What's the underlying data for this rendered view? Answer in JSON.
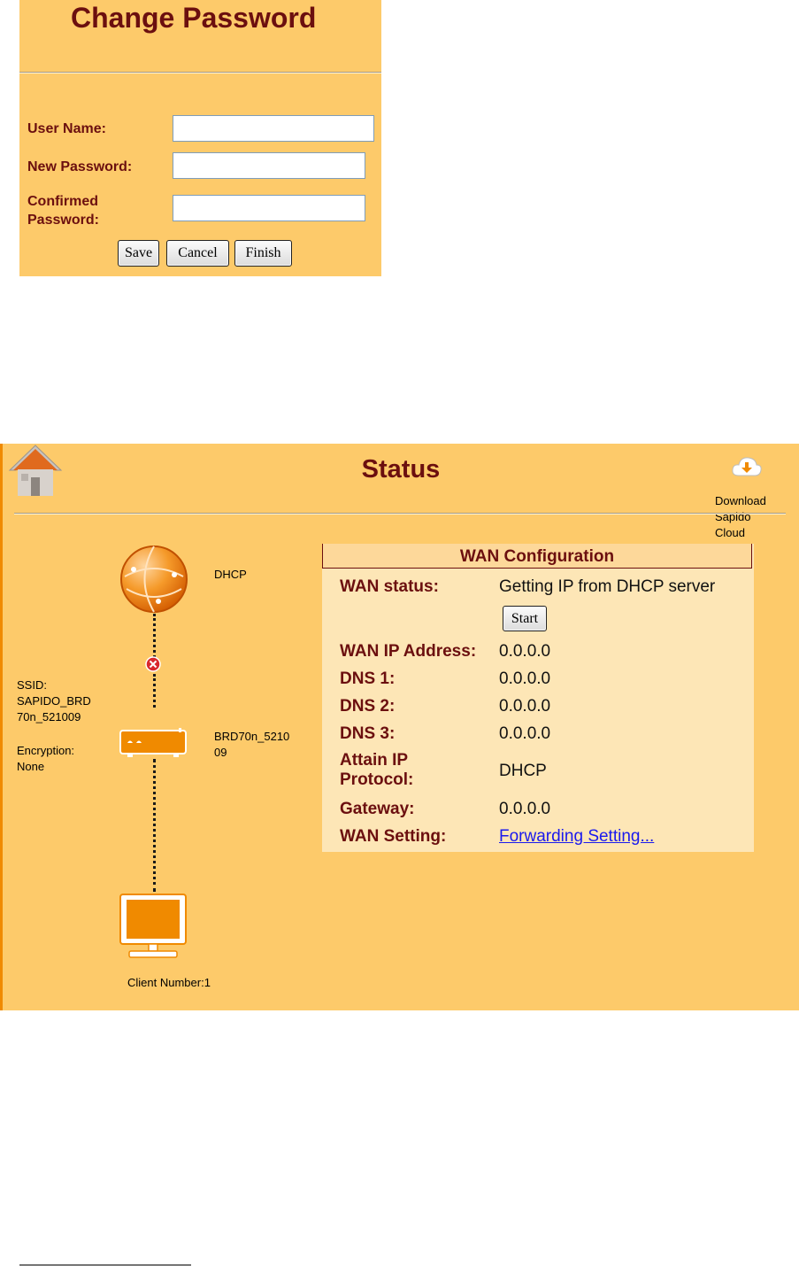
{
  "change_password": {
    "title": "Change Password",
    "user_name_label": "User Name:",
    "user_name_value": "",
    "new_password_label": "New Password:",
    "new_password_value": "",
    "confirmed_password_label_line1": "Confirmed",
    "confirmed_password_label_line2": "Password:",
    "confirmed_password_value": "",
    "buttons": {
      "save": "Save",
      "cancel": "Cancel",
      "finish": "Finish"
    }
  },
  "status": {
    "title": "Status",
    "home_icon": "home-icon",
    "cloud": {
      "icon": "cloud-download-icon",
      "label_line1": "Download",
      "label_line2": "Sapido",
      "label_line3": "Cloud"
    },
    "topology": {
      "internet_label": "DHCP",
      "ssid_line1": "SSID:",
      "ssid_line2": "SAPIDO_BRD",
      "ssid_line3": "70n_521009",
      "encryption_line1": "Encryption:",
      "encryption_line2": "None",
      "router_name_line1": "BRD70n_5210",
      "router_name_line2": "09",
      "client_number": "Client Number:1",
      "link_status": "disconnected"
    },
    "wan": {
      "header": "WAN Configuration",
      "status_label": "WAN status:",
      "status_value": "Getting IP from DHCP server",
      "start_button": "Start",
      "ip_label": "WAN IP Address:",
      "ip_value": "0.0.0.0",
      "dns1_label": "DNS 1:",
      "dns1_value": "0.0.0.0",
      "dns2_label": "DNS 2:",
      "dns2_value": "0.0.0.0",
      "dns3_label": "DNS 3:",
      "dns3_value": "0.0.0.0",
      "protocol_label_line1": "Attain IP",
      "protocol_label_line2": "Protocol:",
      "protocol_value": "DHCP",
      "gateway_label": "Gateway:",
      "gateway_value": "0.0.0.0",
      "setting_label": "WAN Setting:",
      "setting_link": "Forwarding Setting..."
    }
  },
  "colors": {
    "panel_bg": "#fdca6a",
    "label_text": "#6b0f0f",
    "accent_orange": "#f08a00",
    "link": "#1a1aee"
  }
}
